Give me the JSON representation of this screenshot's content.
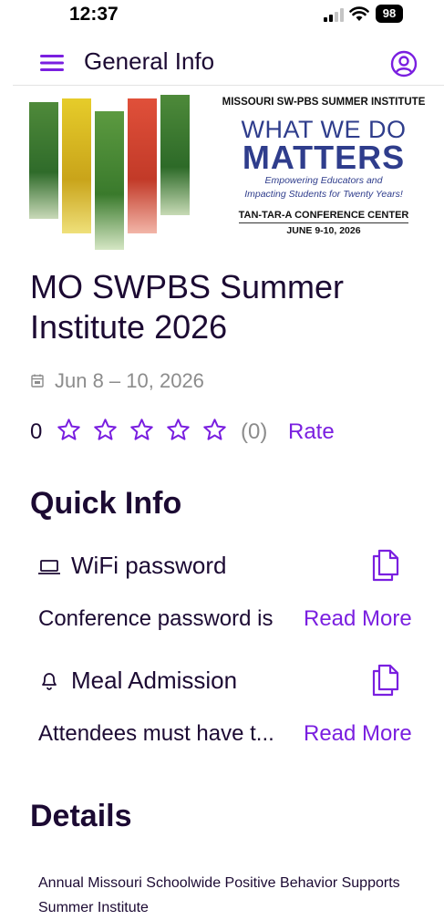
{
  "status_bar": {
    "time": "12:37",
    "battery": "98"
  },
  "header": {
    "title": "General Info"
  },
  "banner": {
    "institute": "MISSOURI SW-PBS SUMMER INSTITUTE",
    "headline_1": "WHAT WE DO",
    "headline_2": "MATTERS",
    "tagline_1": "Empowering Educators and",
    "tagline_2": "Impacting Students for Twenty Years!",
    "venue": "TAN-TAR-A CONFERENCE CENTER",
    "date": "JUNE 9-10, 2026"
  },
  "event": {
    "title": "MO SWPBS Summer Institute 2026",
    "date": "Jun 8 – 10, 2026",
    "rating_value": "0",
    "rating_stars_filled": 0,
    "rating_count": "(0)",
    "rate_label": "Rate"
  },
  "quick_info": {
    "heading": "Quick Info",
    "items": [
      {
        "icon": "laptop-icon",
        "label": "WiFi password",
        "text": "Conference password is",
        "link": "Read More"
      },
      {
        "icon": "bell-icon",
        "label": "Meal Admission",
        "text": "Attendees must have t...",
        "link": "Read More"
      }
    ]
  },
  "details": {
    "heading": "Details",
    "text": "Annual Missouri Schoolwide Positive Behavior Supports Summer Institute"
  },
  "colors": {
    "accent": "#7a1fe0",
    "text": "#1c0a33",
    "muted": "#8c8c8c",
    "banner_blue": "#2f3d8c"
  }
}
